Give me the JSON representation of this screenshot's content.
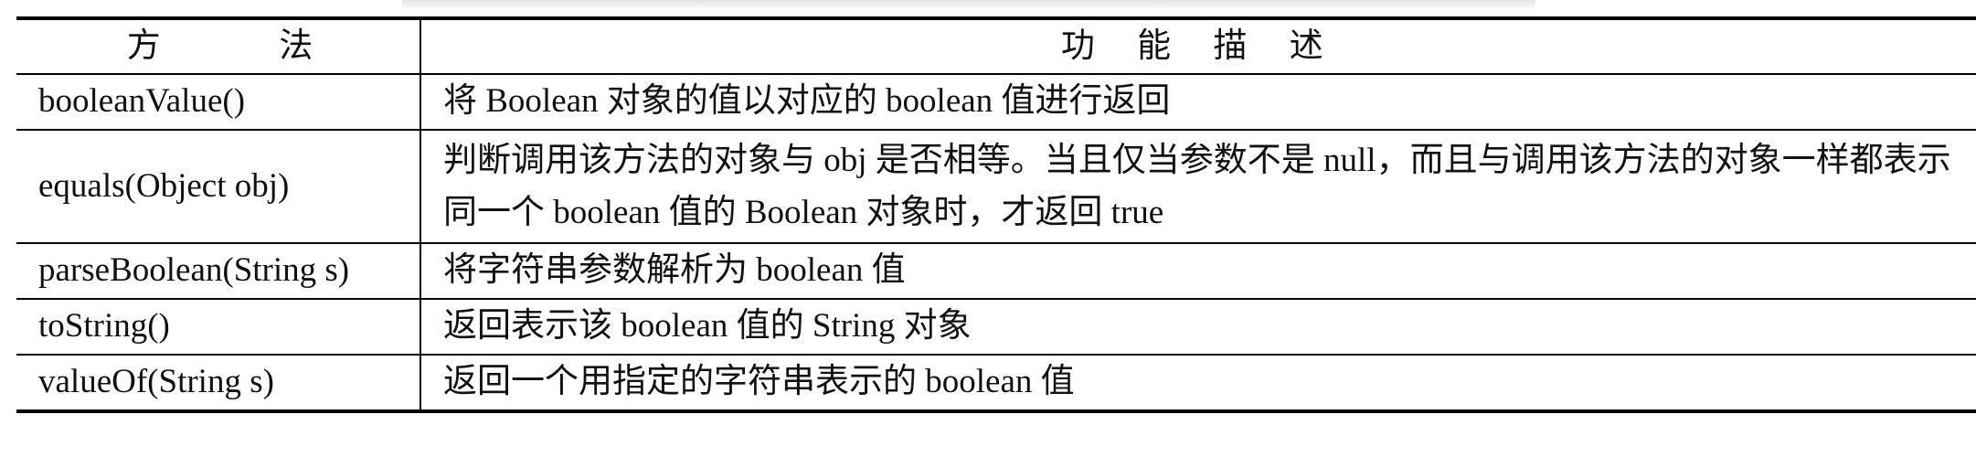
{
  "table": {
    "headers": [
      "方　　法",
      "功 能 描 述"
    ],
    "rows": [
      {
        "method": "booleanValue()",
        "description": "将 Boolean 对象的值以对应的 boolean 值进行返回"
      },
      {
        "method": "equals(Object obj)",
        "description": "判断调用该方法的对象与 obj 是否相等。当且仅当参数不是 null，而且与调用该方法的对象一样都表示同一个 boolean 值的 Boolean 对象时，才返回 true"
      },
      {
        "method": "parseBoolean(String s)",
        "description": "将字符串参数解析为 boolean 值"
      },
      {
        "method": "toString()",
        "description": "返回表示该 boolean 值的 String 对象"
      },
      {
        "method": "valueOf(String s)",
        "description": "返回一个用指定的字符串表示的 boolean 值"
      }
    ]
  }
}
